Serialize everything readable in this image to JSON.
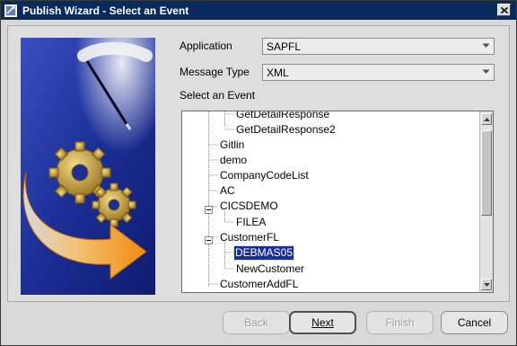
{
  "window": {
    "title": "Publish Wizard - Select an Event"
  },
  "form": {
    "application_label": "Application",
    "application_value": "SAPFL",
    "message_type_label": "Message Type",
    "message_type_value": "XML",
    "event_label": "Select an Event"
  },
  "tree": {
    "nodes": [
      {
        "label": "GetDetailResponse",
        "level": 2
      },
      {
        "label": "GetDetailResponse2",
        "level": 2
      },
      {
        "label": "Gitlin",
        "level": 1
      },
      {
        "label": "demo",
        "level": 1
      },
      {
        "label": "CompanyCodeList",
        "level": 1
      },
      {
        "label": "AC",
        "level": 1
      },
      {
        "label": "CICSDEMO",
        "level": 1,
        "expanded": true
      },
      {
        "label": "FILEA",
        "level": 2
      },
      {
        "label": "CustomerFL",
        "level": 1,
        "expanded": true
      },
      {
        "label": "DEBMAS05",
        "level": 2,
        "selected": true
      },
      {
        "label": "NewCustomer",
        "level": 2
      },
      {
        "label": "CustomerAddFL",
        "level": 1
      }
    ]
  },
  "buttons": {
    "back": "Back",
    "next": "Next",
    "finish": "Finish",
    "cancel": "Cancel"
  },
  "icons": {
    "title_icon": "wizard-app-icon",
    "close_icon": "close-icon",
    "combo_arrow": "chevron-down-icon",
    "graphic": "gears-arrow-wand-illustration"
  },
  "colors": {
    "title_bar": "#0a2a5e",
    "selection": "#1c2e96",
    "graphic_background": "#1c2e96",
    "arrow": "#f0a020",
    "gears": "#c8a23a"
  }
}
